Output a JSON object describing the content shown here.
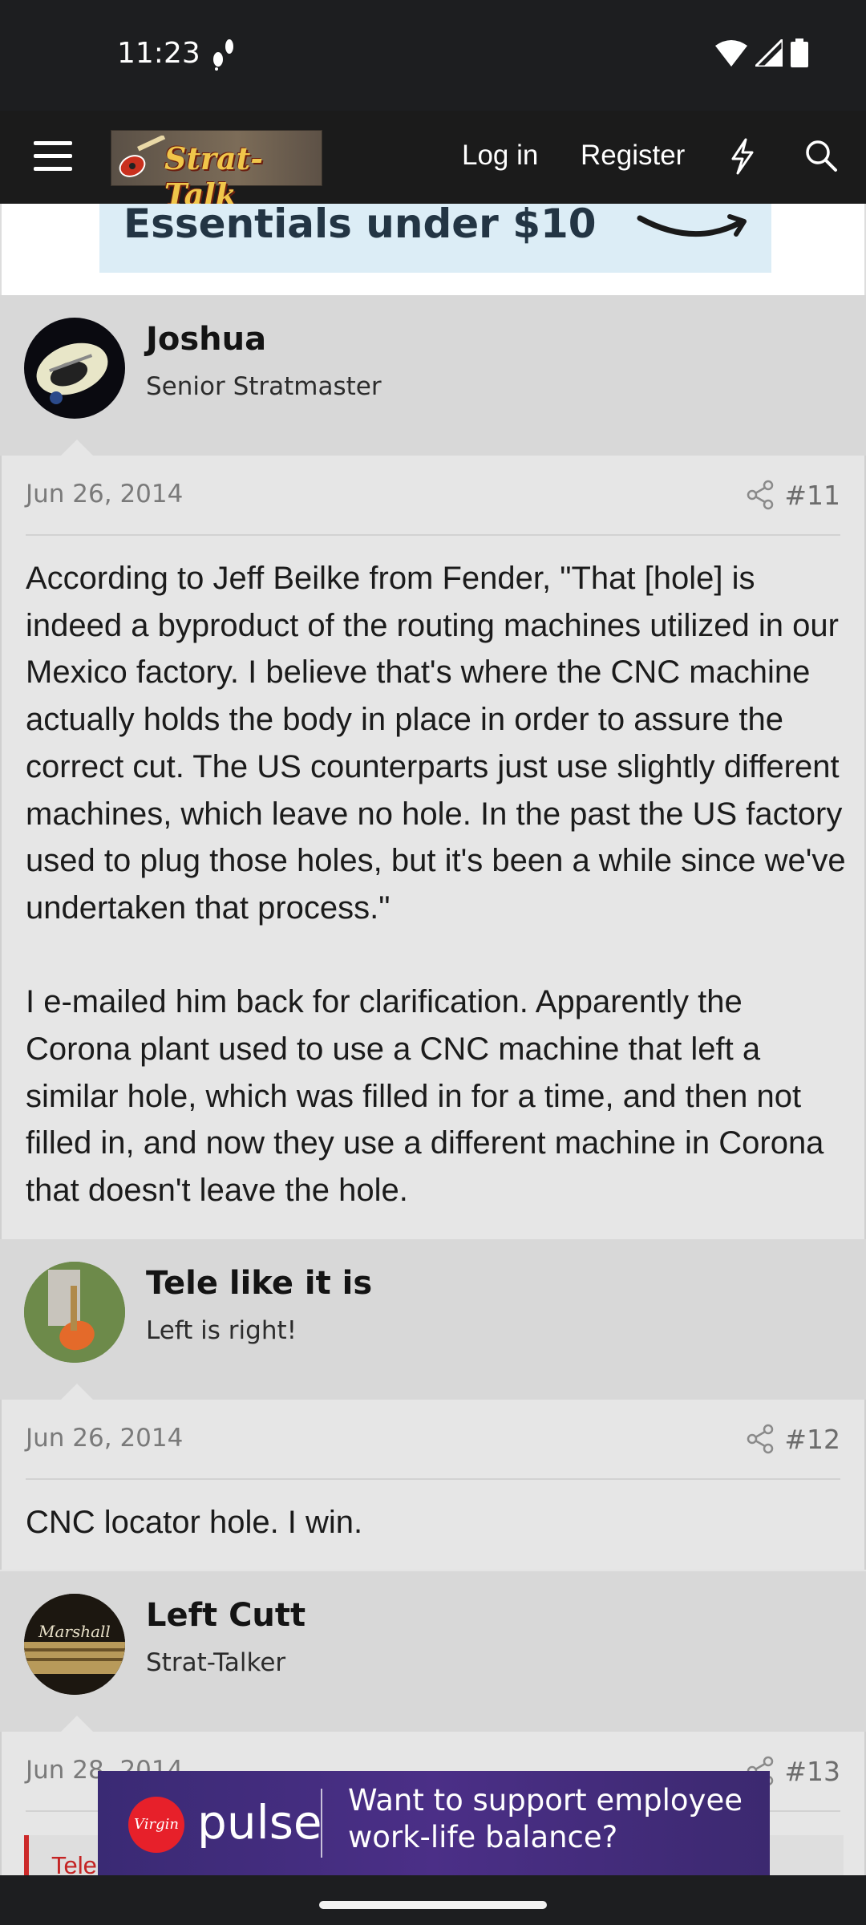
{
  "status_bar": {
    "time": "11:23"
  },
  "header": {
    "logo_text": "Strat-Talk",
    "login_label": "Log in",
    "register_label": "Register"
  },
  "ad_top": {
    "text": "Essentials under $10"
  },
  "posts": [
    {
      "author": "Joshua",
      "user_title": "Senior Stratmaster",
      "date": "Jun 26, 2014",
      "number": "#11",
      "paragraphs": [
        "According to Jeff Beilke from Fender, \"That [hole] is indeed a byproduct of the routing machines utilized in our Mexico factory. I believe that's where the CNC machine actually holds the body in place in order to assure the correct cut. The US counterparts just use slightly different machines, which leave no hole. In the past the US factory used to plug those holes, but it's been a while since we've undertaken that process.\"",
        "I e-mailed him back for clarification. Apparently the Corona plant used to use a CNC machine that left a similar hole, which was filled in for a time, and then not filled in, and now they use a different machine in Corona that doesn't leave the hole."
      ]
    },
    {
      "author": "Tele like it is",
      "user_title": "Left is right!",
      "date": "Jun 26, 2014",
      "number": "#12",
      "paragraphs": [
        "CNC locator hole. I win."
      ]
    },
    {
      "author": "Left Cutt",
      "user_title": "Strat-Talker",
      "date": "Jun 28, 2014",
      "number": "#13",
      "quote_text": "Tele"
    }
  ],
  "ad_bottom": {
    "brand": "pulse",
    "logo_text": "Virgin",
    "line1": "Want to support employee",
    "line2": "work-life balance?"
  },
  "colors": {
    "header_bg": "#1b1b1b",
    "post_bg": "#e6e6e6",
    "author_bg": "#d8d8d8",
    "quote_accent": "#cc2a2a"
  }
}
